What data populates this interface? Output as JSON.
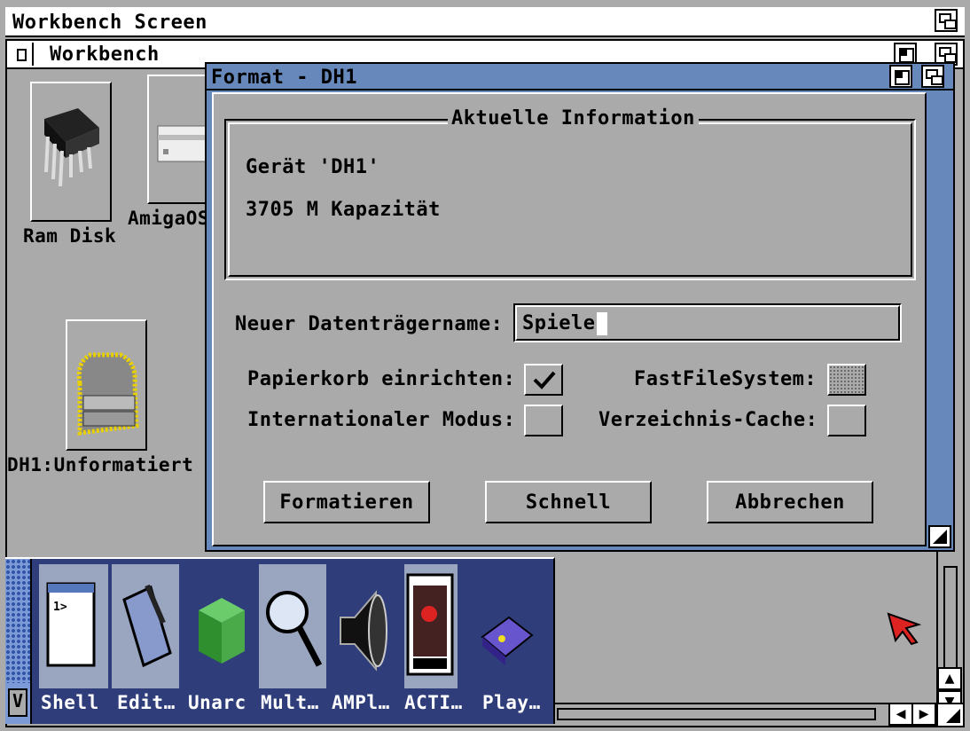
{
  "screen": {
    "title": "Workbench Screen"
  },
  "workbench_window": {
    "title": "Workbench"
  },
  "desktop_icons": [
    {
      "label": "Ram Disk",
      "icon": "ram-chip-icon"
    },
    {
      "label": "AmigaOS",
      "icon": "hard-drive-icon"
    },
    {
      "label": "DH1:Unformatiert",
      "icon": "unformatted-drive-icon"
    }
  ],
  "dialog": {
    "title": "Format - DH1",
    "group_title": "Aktuelle Information",
    "device_text": "Gerät 'DH1'",
    "capacity_text": "3705 M Kapazität",
    "volume_name_label": "Neuer Datenträgername:",
    "volume_name_value": "Spiele",
    "options": {
      "trashcan_label": "Papierkorb einrichten:",
      "trashcan_checked": true,
      "ffs_label": "FastFileSystem:",
      "ffs_checked": false,
      "intl_label": "Internationaler Modus:",
      "intl_checked": false,
      "dircache_label": "Verzeichnis-Cache:",
      "dircache_checked": false
    },
    "buttons": {
      "format": "Formatieren",
      "quick": "Schnell",
      "cancel": "Abbrechen"
    }
  },
  "dock": {
    "items": [
      {
        "label": "Shell",
        "icon": "shell-window-icon"
      },
      {
        "label": "Edit…",
        "icon": "notepad-pen-icon"
      },
      {
        "label": "Unarc",
        "icon": "green-box-icon"
      },
      {
        "label": "Mult…",
        "icon": "magnifier-icon"
      },
      {
        "label": "AMPl…",
        "icon": "speaker-icon"
      },
      {
        "label": "ACTI…",
        "icon": "film-icon"
      },
      {
        "label": "Play…",
        "icon": "disc-player-icon"
      }
    ]
  },
  "colors": {
    "background": "#aaaaaa",
    "dialog_title": "#6688bb",
    "dock": "#2f3d7a"
  }
}
